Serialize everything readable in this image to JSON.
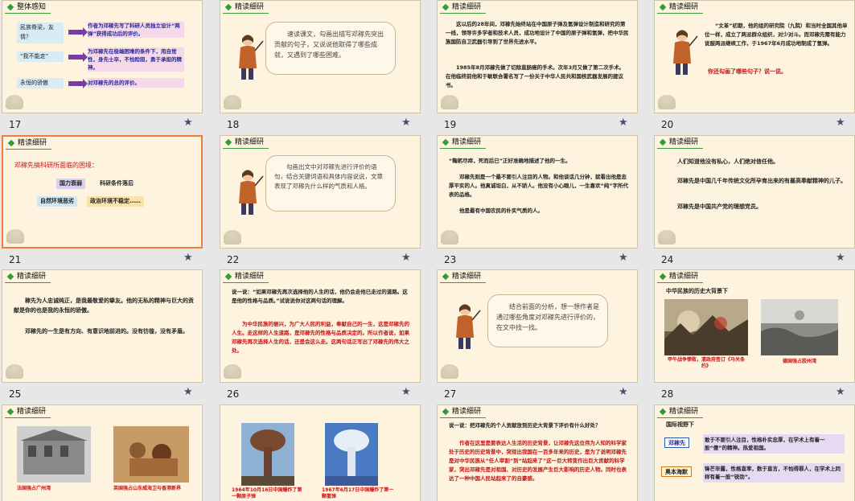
{
  "colors": {
    "selected_border": "#f07c3c",
    "header_accent": "#2e9e38",
    "star": "#45526a"
  },
  "star_icon": "★",
  "slides": [
    {
      "num": "17",
      "title": "整体感知",
      "rows": [
        {
          "label": "民族脊梁，友情？",
          "text": "作者为邓稼先写了科研人员独立设计“两弹”获得成功后的评价。"
        },
        {
          "label": "“我不能走”",
          "text": "为邓稼先在极端困难的条件下，用自觉性，身先士卒，不怕险阻，勇于承担的精神。"
        },
        {
          "label": "永恒的骄傲",
          "text": "对邓稼先的总的评价。"
        }
      ]
    },
    {
      "num": "18",
      "title": "精读细研",
      "text": "速读课文，勾画出描写邓稼先突出贡献的句子，又说说他取得了哪些成就，又遇到了哪些困难。"
    },
    {
      "num": "19",
      "title": "精读细研",
      "p1": "这以后的28年间，邓稼先始终站在中国原子弹及氢弹设计制造和研究的第一线，领导许多学者和技术人员，成功地设计了中国的原子弹和氢弹，把中华民族国防自卫武器引导到了世界先进水平。",
      "p2": "1985年8月邓稼先做了切除直肠癌的手术。次年3月又做了第二次手术。在他临终前他和于敏联合署名写了一份关于中华人民共和国核武器发展的建议书。"
    },
    {
      "num": "20",
      "title": "精读细研",
      "text": "“文革”初期，他的组的研究院（九院）和当时全国其他单位一样，成立了两派群众组织，对少对斗。而邓稼先需有能力说服两派继续工作，于1967年6月成功地制成了氢弹。",
      "q": "你还勾画了哪些句子？说一说。"
    },
    {
      "num": "21",
      "title": "精读细研",
      "lead": "邓稼先搞科研所面临的困境：",
      "tags": [
        "国力衰弱",
        "科研条件落后",
        "自然环境恶劣",
        "政治环境不稳定……"
      ]
    },
    {
      "num": "22",
      "title": "精读细研",
      "text": "勾画出文中对邓稼先进行评价的语句，结合关键词语和具体内容说说，文章表现了邓稼先什么样的气质和人格。"
    },
    {
      "num": "23",
      "title": "精读细研",
      "l1": "“鞠躬尽瘁，死而后已”正好准确地描述了他的一生。",
      "l2": "邓稼先则是一个最不要引人注目的人物。和他谈话几分钟，就看出他是忠厚平实的人。他真诚坦白，从不骄人。他没有小心眼儿，一生喜欢“纯”字所代表的品格。",
      "l3": "他是最有中国农民的朴实气质的人。"
    },
    {
      "num": "24",
      "title": "精读细研",
      "l1": "人们知道他没有私心，人们绝对信任他。",
      "l2": "邓稼先是中国几千年传统文化所孕育出来的有最高奉献精神的儿子。",
      "l3": "邓稼先是中国共产党的理想党员。"
    },
    {
      "num": "25",
      "title": "精读细研",
      "l1": "稼先为人忠诚纯正，是我最敬爱的挚友。他的无私的精神与巨大的贡献是你的也是我的永恒的骄傲。",
      "l2": "邓稼先的一生是有方向、有意识地前进的。没有彷徨，没有矛盾。"
    },
    {
      "num": "26",
      "title": "精读细研",
      "l1": "说一说：“如果邓稼先再次选择他的人生的话，他仍会走他已走过的道路。这是他的性格与品质。”试说说你对这两句话的理解。",
      "l2": "为中华民族的振兴，为广大人民的利益，奉献自己的一生，这是邓稼先的人生。走这样的人生道路，是邓稼先的性格与品质决定的。所以作者说，如果邓稼先再次选择人生的话，还是会这么走。这两句话正写出了邓稼先的伟大之处。"
    },
    {
      "num": "27",
      "title": "精读细研",
      "text": "结合前面的分析，想一想作者是通过哪些角度对邓稼先进行评价的，在文中找一找。"
    },
    {
      "num": "28",
      "title": "精读细研",
      "sub": "中华民族的历史大背景下",
      "cap1": "甲午战争惨败，清政府签订《马关条约》",
      "cap2": "德国强占胶州湾"
    },
    {
      "num": "",
      "title": "精读细研",
      "cap1": "法国强占广州湾",
      "cap2": "英国强占山东威海卫与香港新界"
    },
    {
      "num": "",
      "title": "",
      "cap1": "1964年10月16日中国爆炸了第一颗原子弹",
      "cap2": "1967年6月17日中国爆炸了第一颗氢弹"
    },
    {
      "num": "",
      "title": "精读细研",
      "l1": "说一说：把邓稼先的个人贡献放到历史大背景下评价有什么好处？",
      "l2": "作者在这里是要表达人生活的历史背景，让邓稼先这位伟为人知的科学家处于历史的历史背景中，突现出我国在一百多年来的历史，是为了说明邓稼先是对中华民族从“任人宰割”到“站起来了”这一巨大转变作出巨大贡献的科学家，突出邓稼先是对祖国、对历史的发展产生巨大影响的历史人物。同时也表达了一种中国人民站起来了的自豪感。"
    },
    {
      "num": "",
      "title": "精读细研",
      "sub": "国际视野下",
      "n1": "邓稼先",
      "t1": "敢于不要引人注目，性格朴实忠厚，在学术上有着一股“傻”的精神。热爱祖国。",
      "n2": "奥本海默",
      "t2": "锋芒毕露，性格直率，数于直言，不怕得罪人，在学术上同样有着一股“锐劲”。"
    }
  ]
}
